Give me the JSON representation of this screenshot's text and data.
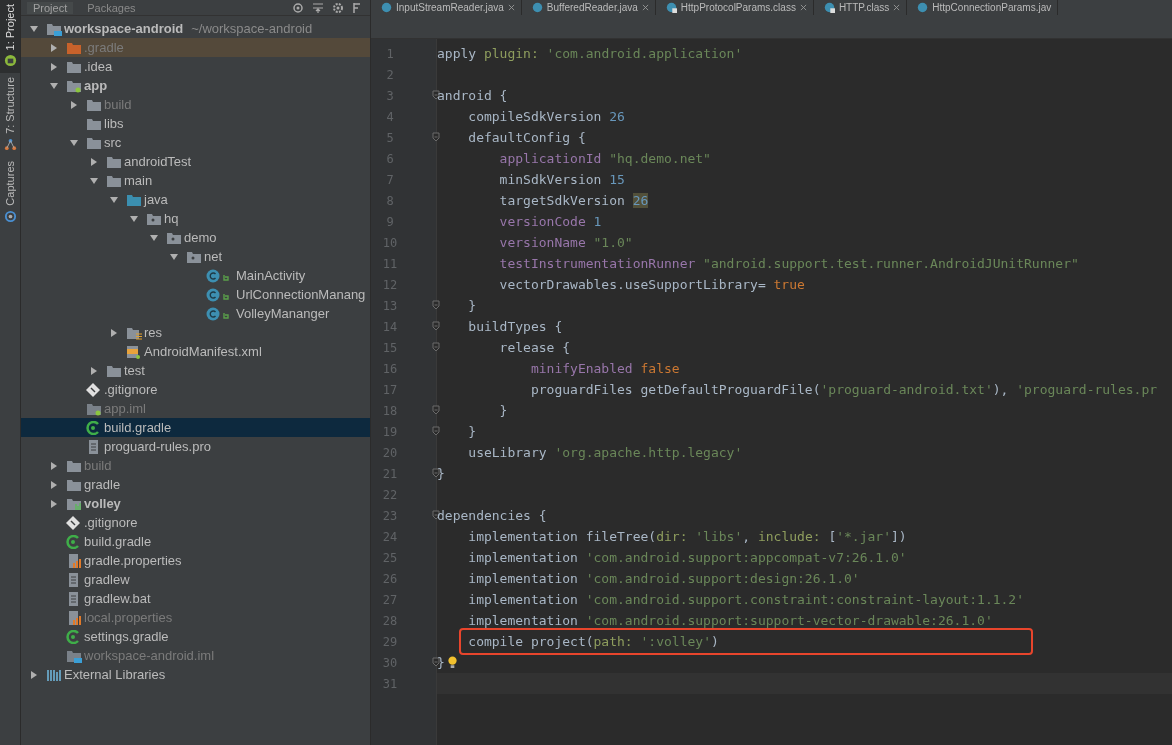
{
  "side_strip": [
    {
      "label": "1: Project",
      "selected": true
    },
    {
      "label": "7: Structure",
      "selected": false
    },
    {
      "label": "Captures",
      "selected": false
    }
  ],
  "tool_tabs": [
    {
      "label": "Project",
      "selected": true
    },
    {
      "label": "Packages",
      "selected": false
    }
  ],
  "tree": [
    {
      "label": "workspace-android",
      "hint": "~/workspace-android",
      "kind": "root",
      "bold": true,
      "expanded": true,
      "selected": false,
      "children": [
        {
          "label": ".gradle",
          "kind": "folder-orange",
          "expanded": false,
          "dim": true,
          "tinted": true,
          "selected": false
        },
        {
          "label": ".idea",
          "kind": "folder",
          "expanded": false,
          "selected": false
        },
        {
          "label": "app",
          "kind": "module",
          "bold": true,
          "expanded": true,
          "selected": false,
          "children": [
            {
              "label": "build",
              "kind": "folder",
              "expanded": false,
              "dim": true,
              "selected": false
            },
            {
              "label": "libs",
              "kind": "folder",
              "selected": false
            },
            {
              "label": "src",
              "kind": "folder",
              "expanded": true,
              "selected": false,
              "children": [
                {
                  "label": "androidTest",
                  "kind": "folder",
                  "expanded": false,
                  "selected": false
                },
                {
                  "label": "main",
                  "kind": "folder",
                  "expanded": true,
                  "selected": false,
                  "children": [
                    {
                      "label": "java",
                      "kind": "source",
                      "expanded": true,
                      "selected": false,
                      "children": [
                        {
                          "label": "hq",
                          "kind": "package",
                          "expanded": true,
                          "selected": false,
                          "children": [
                            {
                              "label": "demo",
                              "kind": "package",
                              "expanded": true,
                              "selected": false,
                              "children": [
                                {
                                  "label": "net",
                                  "kind": "package",
                                  "expanded": true,
                                  "selected": false,
                                  "children": [
                                    {
                                      "label": "MainActivity",
                                      "kind": "class",
                                      "selected": false
                                    },
                                    {
                                      "label": "UrlConnectionManang",
                                      "kind": "class",
                                      "selected": false
                                    },
                                    {
                                      "label": "VolleyMananger",
                                      "kind": "class",
                                      "selected": false
                                    }
                                  ]
                                }
                              ]
                            }
                          ]
                        }
                      ]
                    },
                    {
                      "label": "res",
                      "kind": "resources",
                      "expanded": false,
                      "selected": false
                    },
                    {
                      "label": "AndroidManifest.xml",
                      "kind": "manifest",
                      "selected": false
                    }
                  ]
                },
                {
                  "label": "test",
                  "kind": "folder",
                  "expanded": false,
                  "selected": false
                }
              ]
            },
            {
              "label": ".gitignore",
              "kind": "ignore",
              "selected": false
            },
            {
              "label": "app.iml",
              "kind": "iml",
              "dim": true,
              "selected": false
            },
            {
              "label": "build.gradle",
              "kind": "gradle",
              "selected": true
            },
            {
              "label": "proguard-rules.pro",
              "kind": "text",
              "selected": false
            }
          ]
        },
        {
          "label": "build",
          "kind": "folder",
          "expanded": false,
          "dim": true,
          "selected": false
        },
        {
          "label": "gradle",
          "kind": "folder",
          "expanded": false,
          "selected": false
        },
        {
          "label": "volley",
          "kind": "library",
          "bold": true,
          "expanded": false,
          "selected": false
        },
        {
          "label": ".gitignore",
          "kind": "ignore",
          "selected": false
        },
        {
          "label": "build.gradle",
          "kind": "gradle",
          "selected": false
        },
        {
          "label": "gradle.properties",
          "kind": "properties",
          "selected": false
        },
        {
          "label": "gradlew",
          "kind": "text",
          "selected": false
        },
        {
          "label": "gradlew.bat",
          "kind": "text",
          "selected": false
        },
        {
          "label": "local.properties",
          "kind": "properties",
          "dim": true,
          "selected": false
        },
        {
          "label": "settings.gradle",
          "kind": "gradle",
          "selected": false
        },
        {
          "label": "workspace-android.iml",
          "kind": "rootiml",
          "dim": true,
          "selected": false
        }
      ]
    },
    {
      "label": "External Libraries",
      "kind": "libraries",
      "expanded": false,
      "selected": false
    }
  ],
  "editor_tabs": [
    {
      "label": "InputStreamReader.java",
      "closable": true,
      "locked": false,
      "selected": false
    },
    {
      "label": "BufferedReader.java",
      "closable": true,
      "locked": false,
      "selected": false
    },
    {
      "label": "HttpProtocolParams.class",
      "closable": true,
      "locked": true,
      "selected": false
    },
    {
      "label": "HTTP.class",
      "closable": true,
      "locked": true,
      "selected": false
    },
    {
      "label": "HttpConnectionParams.jav",
      "closable": false,
      "locked": false,
      "selected": false
    }
  ],
  "code": [
    {
      "number": "1",
      "tokens": [
        {
          "kind": "plain",
          "text": "apply "
        },
        {
          "kind": "param",
          "text": "plugin: "
        },
        {
          "kind": "str",
          "text": "'com.android.application'"
        }
      ]
    },
    {
      "number": "2"
    },
    {
      "number": "3",
      "fold": true,
      "tokens": [
        {
          "kind": "plain",
          "text": "android {"
        }
      ]
    },
    {
      "number": "4",
      "tokens": [
        {
          "kind": "plain",
          "text": "    compileSdkVersion "
        },
        {
          "kind": "num",
          "text": "26"
        }
      ]
    },
    {
      "number": "5",
      "fold": true,
      "tokens": [
        {
          "kind": "plain",
          "text": "    defaultConfig {"
        }
      ]
    },
    {
      "number": "6",
      "tokens": [
        {
          "kind": "key",
          "text": "        applicationId "
        },
        {
          "kind": "str",
          "text": "\"hq.demo.net\""
        }
      ]
    },
    {
      "number": "7",
      "tokens": [
        {
          "kind": "plain",
          "text": "        minSdkVersion "
        },
        {
          "kind": "num",
          "text": "15"
        }
      ]
    },
    {
      "number": "8",
      "tokens": [
        {
          "kind": "plain",
          "text": "        targetSdkVersion "
        },
        {
          "kind": "num-marked",
          "text": "26"
        }
      ]
    },
    {
      "number": "9",
      "tokens": [
        {
          "kind": "key",
          "text": "        versionCode "
        },
        {
          "kind": "num",
          "text": "1"
        }
      ]
    },
    {
      "number": "10",
      "tokens": [
        {
          "kind": "key",
          "text": "        versionName "
        },
        {
          "kind": "str",
          "text": "\"1.0\""
        }
      ]
    },
    {
      "number": "11",
      "tokens": [
        {
          "kind": "key",
          "text": "        testInstrumentationRunner "
        },
        {
          "kind": "str",
          "text": "\"android.support.test.runner.AndroidJUnitRunner\""
        }
      ]
    },
    {
      "number": "12",
      "tokens": [
        {
          "kind": "plain",
          "text": "        vectorDrawables.useSupportLibrary= "
        },
        {
          "kind": "lit",
          "text": "true"
        }
      ]
    },
    {
      "number": "13",
      "fold": true,
      "tokens": [
        {
          "kind": "plain",
          "text": "    }"
        }
      ]
    },
    {
      "number": "14",
      "fold": true,
      "tokens": [
        {
          "kind": "plain",
          "text": "    buildTypes {"
        }
      ]
    },
    {
      "number": "15",
      "fold": true,
      "tokens": [
        {
          "kind": "plain",
          "text": "        release {"
        }
      ]
    },
    {
      "number": "16",
      "tokens": [
        {
          "kind": "key",
          "text": "            minifyEnabled "
        },
        {
          "kind": "lit",
          "text": "false"
        }
      ]
    },
    {
      "number": "17",
      "tokens": [
        {
          "kind": "plain",
          "text": "            proguardFiles getDefaultProguardFile("
        },
        {
          "kind": "str",
          "text": "'proguard-android.txt'"
        },
        {
          "kind": "plain",
          "text": "), "
        },
        {
          "kind": "str",
          "text": "'proguard-rules.pr"
        }
      ]
    },
    {
      "number": "18",
      "fold": true,
      "tokens": [
        {
          "kind": "plain",
          "text": "        }"
        }
      ]
    },
    {
      "number": "19",
      "fold": true,
      "tokens": [
        {
          "kind": "plain",
          "text": "    }"
        }
      ]
    },
    {
      "number": "20",
      "tokens": [
        {
          "kind": "plain",
          "text": "    useLibrary "
        },
        {
          "kind": "str",
          "text": "'org.apache.http.legacy'"
        }
      ]
    },
    {
      "number": "21",
      "fold": true,
      "tokens": [
        {
          "kind": "plain",
          "text": "}"
        }
      ]
    },
    {
      "number": "22"
    },
    {
      "number": "23",
      "fold": true,
      "tokens": [
        {
          "kind": "plain",
          "text": "dependencies {"
        }
      ]
    },
    {
      "number": "24",
      "tokens": [
        {
          "kind": "plain",
          "text": "    implementation fileTree("
        },
        {
          "kind": "param",
          "text": "dir: "
        },
        {
          "kind": "str",
          "text": "'libs'"
        },
        {
          "kind": "plain",
          "text": ", "
        },
        {
          "kind": "param",
          "text": "include: "
        },
        {
          "kind": "plain",
          "text": "["
        },
        {
          "kind": "str",
          "text": "'*.jar'"
        },
        {
          "kind": "plain",
          "text": "])"
        }
      ]
    },
    {
      "number": "25",
      "tokens": [
        {
          "kind": "plain",
          "text": "    implementation "
        },
        {
          "kind": "str",
          "text": "'com.android.support:appcompat-v7:26.1.0'"
        }
      ]
    },
    {
      "number": "26",
      "tokens": [
        {
          "kind": "plain",
          "text": "    implementation "
        },
        {
          "kind": "str",
          "text": "'com.android.support:design:26.1.0'"
        }
      ]
    },
    {
      "number": "27",
      "tokens": [
        {
          "kind": "plain",
          "text": "    implementation "
        },
        {
          "kind": "str",
          "text": "'com.android.support.constraint:constraint-layout:1.1.2'"
        }
      ]
    },
    {
      "number": "28",
      "tokens": [
        {
          "kind": "plain",
          "text": "    implementation "
        },
        {
          "kind": "str",
          "text": "'com.android.support:support-vector-drawable:26.1.0'"
        }
      ]
    },
    {
      "number": "29",
      "boxed": true,
      "tokens": [
        {
          "kind": "plain",
          "text": "    compile project("
        },
        {
          "kind": "param",
          "text": "path: "
        },
        {
          "kind": "str",
          "text": "':volley'"
        },
        {
          "kind": "plain",
          "text": ")"
        }
      ]
    },
    {
      "number": "30",
      "fold": true,
      "bulb": true,
      "tokens": [
        {
          "kind": "plain",
          "text": "}"
        }
      ]
    },
    {
      "number": "31",
      "current": true
    }
  ]
}
